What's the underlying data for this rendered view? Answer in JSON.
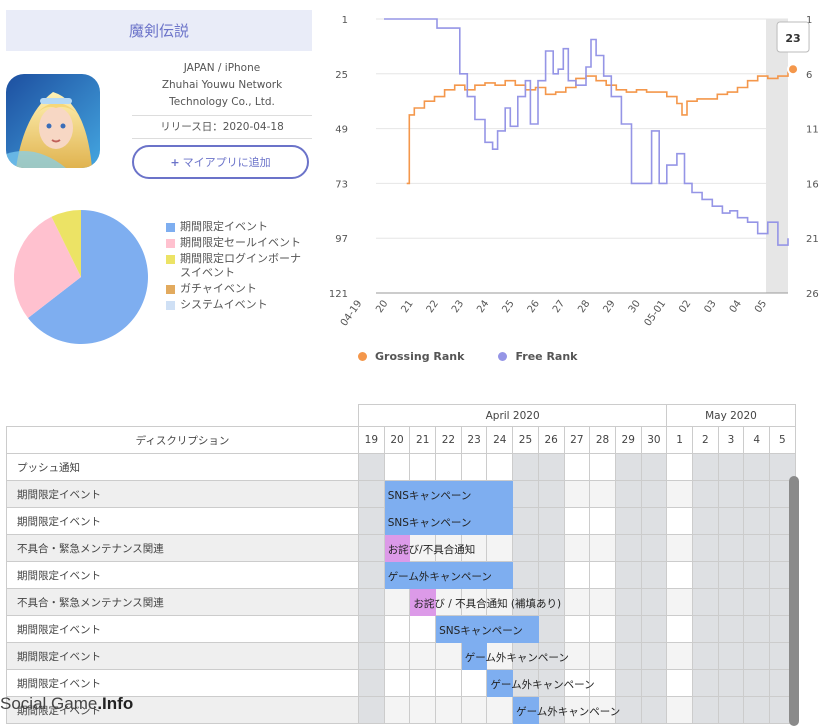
{
  "app": {
    "title": "魔剣伝説",
    "region": "JAPAN / iPhone",
    "developer_line1": "Zhuhai Youwu Network",
    "developer_line2": "Technology Co., Ltd.",
    "release": "リリース日：2020-04-18",
    "add_button": "マイアプリに追加"
  },
  "pie_legend": [
    {
      "label": "期間限定イベント",
      "color": "#7eaef0"
    },
    {
      "label": "期間限定セールイベント",
      "color": "#ffc1cf"
    },
    {
      "label": "期間限定ログインボーナスイベント",
      "color": "#ece365"
    },
    {
      "label": "ガチャイベント",
      "color": "#e2aa5e"
    },
    {
      "label": "システムイベント",
      "color": "#cfe0f5"
    }
  ],
  "chart_data": {
    "type": "line",
    "left_axis": {
      "ticks": [
        "1",
        "25",
        "49",
        "73",
        "97",
        "121"
      ]
    },
    "right_axis": {
      "ticks": [
        "1",
        "6",
        "11",
        "16",
        "21",
        "26"
      ]
    },
    "x_ticks": [
      "04-19",
      "20",
      "21",
      "22",
      "23",
      "24",
      "25",
      "26",
      "27",
      "28",
      "29",
      "30",
      "05-01",
      "02",
      "03",
      "04",
      "05"
    ],
    "tooltip_value": "23",
    "series": [
      {
        "name": "Grossing Rank",
        "color": "#f4974b",
        "values": [
          [
            0.9,
            73
          ],
          [
            1.0,
            43
          ],
          [
            1.2,
            40
          ],
          [
            1.6,
            37
          ],
          [
            2.0,
            35
          ],
          [
            2.4,
            32
          ],
          [
            2.8,
            30
          ],
          [
            3.2,
            32
          ],
          [
            3.6,
            30
          ],
          [
            4.0,
            29
          ],
          [
            4.4,
            30
          ],
          [
            4.8,
            28
          ],
          [
            5.2,
            30
          ],
          [
            5.6,
            32
          ],
          [
            6.0,
            31
          ],
          [
            6.4,
            34
          ],
          [
            6.8,
            33
          ],
          [
            7.2,
            31
          ],
          [
            7.6,
            27
          ],
          [
            8.0,
            26
          ],
          [
            8.4,
            28
          ],
          [
            8.8,
            30
          ],
          [
            9.2,
            32
          ],
          [
            9.6,
            33
          ],
          [
            10.0,
            32
          ],
          [
            10.4,
            33
          ],
          [
            10.8,
            33
          ],
          [
            11.2,
            35
          ],
          [
            11.6,
            38
          ],
          [
            11.8,
            43
          ],
          [
            12.0,
            37
          ],
          [
            12.4,
            36
          ],
          [
            12.8,
            36
          ],
          [
            13.2,
            34
          ],
          [
            13.6,
            33
          ],
          [
            14.0,
            31
          ],
          [
            14.4,
            28
          ],
          [
            14.8,
            26
          ],
          [
            15.2,
            27
          ],
          [
            15.6,
            26
          ],
          [
            16.0,
            24
          ],
          [
            16.2,
            23
          ]
        ]
      },
      {
        "name": "Free Rank",
        "color": "#9595e6",
        "values": [
          [
            0.0,
            1
          ],
          [
            2.0,
            1
          ],
          [
            2.1,
            5
          ],
          [
            2.9,
            5
          ],
          [
            3.0,
            25
          ],
          [
            3.3,
            35
          ],
          [
            3.6,
            45
          ],
          [
            4.0,
            55
          ],
          [
            4.3,
            58
          ],
          [
            4.5,
            50
          ],
          [
            4.8,
            40
          ],
          [
            5.0,
            48
          ],
          [
            5.3,
            35
          ],
          [
            5.6,
            28
          ],
          [
            5.8,
            47
          ],
          [
            6.1,
            28
          ],
          [
            6.4,
            15
          ],
          [
            6.7,
            25
          ],
          [
            6.9,
            23
          ],
          [
            7.1,
            14
          ],
          [
            7.3,
            28
          ],
          [
            7.6,
            30
          ],
          [
            8.0,
            22
          ],
          [
            8.2,
            10
          ],
          [
            8.4,
            17
          ],
          [
            8.7,
            26
          ],
          [
            9.0,
            35
          ],
          [
            9.4,
            47
          ],
          [
            9.8,
            73
          ],
          [
            10.3,
            73
          ],
          [
            10.6,
            50
          ],
          [
            10.9,
            73
          ],
          [
            11.2,
            65
          ],
          [
            11.6,
            60
          ],
          [
            11.9,
            73
          ],
          [
            12.2,
            77
          ],
          [
            12.6,
            80
          ],
          [
            13.0,
            83
          ],
          [
            13.4,
            86
          ],
          [
            13.7,
            85
          ],
          [
            14.0,
            88
          ],
          [
            14.4,
            90
          ],
          [
            14.8,
            95
          ],
          [
            15.2,
            90
          ],
          [
            15.6,
            100
          ],
          [
            16.0,
            97
          ]
        ]
      }
    ]
  },
  "calendar": {
    "months": [
      {
        "label": "April 2020"
      },
      {
        "label": "May 2020"
      }
    ],
    "header_label": "ディスクリプション",
    "days": [
      "19",
      "20",
      "21",
      "22",
      "23",
      "24",
      "25",
      "26",
      "27",
      "28",
      "29",
      "30",
      "1",
      "2",
      "3",
      "4",
      "5"
    ],
    "weekend_idx": [
      0,
      6,
      7,
      10,
      11,
      13,
      14,
      15,
      16
    ],
    "rows": [
      {
        "label": "プッシュ通知"
      },
      {
        "label": "期間限定イベント",
        "bar_label": "SNSキャンペーン",
        "color": "#7eaef0"
      },
      {
        "label": "期間限定イベント",
        "bar_label": "SNSキャンペーン",
        "color": "#7eaef0"
      },
      {
        "label": "不具合・緊急メンテナンス関連",
        "bar_label": "お詫び/不具合通知",
        "color": "#dc9ae8"
      },
      {
        "label": "期間限定イベント",
        "bar_label": "ゲーム外キャンペーン",
        "color": "#7eaef0"
      },
      {
        "label": "不具合・緊急メンテナンス関連",
        "bar_label": "お詫び / 不具合通知 (補填あり)",
        "color": "#dc9ae8"
      },
      {
        "label": "期間限定イベント",
        "bar_label": "SNSキャンペーン",
        "color": "#7eaef0"
      },
      {
        "label": "期間限定イベント",
        "bar_label": "ゲーム外キャンペーン",
        "color": "#7eaef0"
      },
      {
        "label": "期間限定イベント",
        "bar_label": "ゲーム外キャンペーン",
        "color": "#7eaef0"
      },
      {
        "label": "期間限定イベント",
        "bar_label": "ゲーム外キャンペーン",
        "color": "#7eaef0"
      }
    ]
  },
  "watermark": {
    "text_a": "Social Game",
    "text_b": ".Info"
  }
}
